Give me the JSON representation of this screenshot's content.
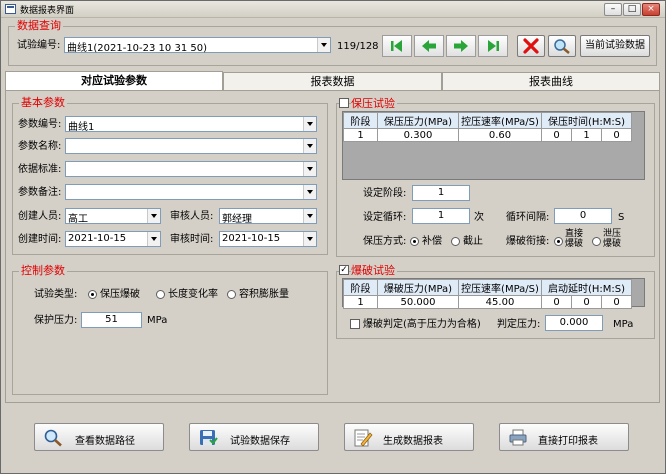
{
  "window": {
    "title": "数据报表界面"
  },
  "query": {
    "group_label": "数据查询",
    "test_no_label": "试验编号:",
    "test_no_value": "曲线1(2021-10-23 10 31 50)",
    "record_counter": "119/128",
    "current_data_button": "当前试验数据"
  },
  "tabs": [
    "对应试验参数",
    "报表数据",
    "报表曲线"
  ],
  "basic": {
    "group_label": "基本参数",
    "param_no_label": "参数编号:",
    "param_no_value": "曲线1",
    "param_name_label": "参数名称:",
    "basis_label": "依据标准:",
    "remark_label": "参数备注:",
    "creator_label": "创建人员:",
    "creator_value": "高工",
    "reviewer_label": "审核人员:",
    "reviewer_value": "郭经理",
    "create_time_label": "创建时间:",
    "create_time_value": "2021-10-15",
    "review_time_label": "审核时间:",
    "review_time_value": "2021-10-15"
  },
  "control": {
    "group_label": "控制参数",
    "type_label": "试验类型:",
    "types": [
      "保压爆破",
      "长度变化率",
      "容积膨胀量"
    ],
    "protect_label": "保护压力:",
    "protect_value": "51",
    "protect_unit": "MPa"
  },
  "hold": {
    "group_label": "保压试验",
    "headers": [
      "阶段",
      "保压压力(MPa)",
      "控压速率(MPa/S)",
      "保压时间(H:M:S)"
    ],
    "row": [
      "1",
      "0.300",
      "0.60",
      "0",
      "1",
      "0"
    ],
    "set_stage_label": "设定阶段:",
    "set_stage_value": "1",
    "set_cycle_label": "设定循环:",
    "set_cycle_value": "1",
    "set_cycle_unit": "次",
    "cycle_interval_label": "循环间隔:",
    "cycle_interval_value": "0",
    "cycle_interval_unit": "S",
    "mode_label": "保压方式:",
    "modes": [
      "补偿",
      "截止"
    ],
    "burst_link_label": "爆破衔接:",
    "burst_link_opt1": [
      "直接",
      "爆破"
    ],
    "burst_link_opt2": [
      "泄压",
      "爆破"
    ]
  },
  "burst": {
    "group_label": "爆破试验",
    "check_mark": "✓",
    "headers": [
      "阶段",
      "爆破压力(MPa)",
      "控压速率(MPa/S)",
      "启动延时(H:M:S)"
    ],
    "row": [
      "1",
      "50.000",
      "45.00",
      "0",
      "0",
      "0"
    ],
    "judge_label": "爆破判定(高于压力为合格)",
    "judge_pressure_label": "判定压力:",
    "judge_pressure_value": "0.000",
    "judge_pressure_unit": "MPa"
  },
  "bottom": {
    "view_path": "查看数据路径",
    "save": "试验数据保存",
    "report": "生成数据报表",
    "print": "直接打印报表"
  },
  "colors": {
    "accent_red": "#e00000",
    "nav_green": "#2aa53a",
    "table_header": "#e0ebf8"
  }
}
